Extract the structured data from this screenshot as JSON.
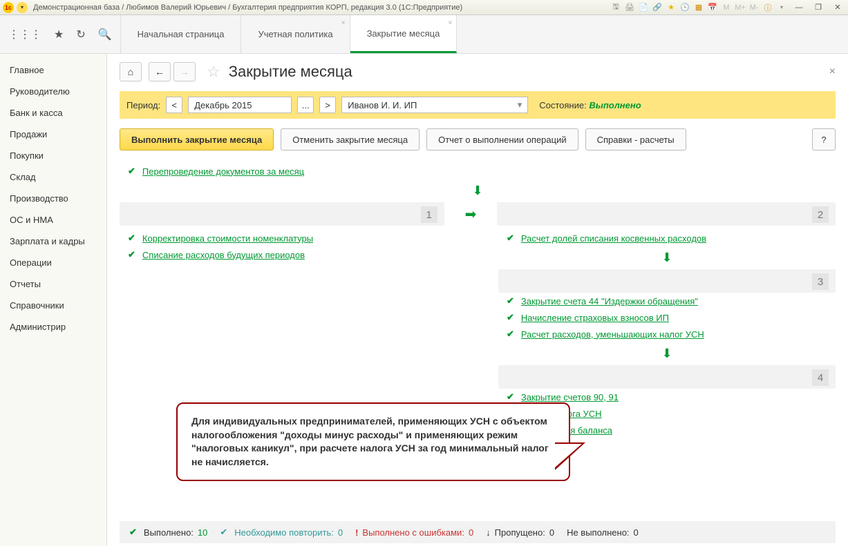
{
  "titlebar": {
    "title": "Демонстрационная база / Любимов Валерий Юрьевич / Бухгалтерия предприятия КОРП, редакция 3.0  (1С:Предприятие)",
    "m_labels": [
      "M",
      "M+",
      "M-"
    ]
  },
  "tabs": {
    "start": "Начальная страница",
    "policy": "Учетная политика",
    "close_month": "Закрытие месяца"
  },
  "sidebar": {
    "items": [
      "Главное",
      "Руководителю",
      "Банк и касса",
      "Продажи",
      "Покупки",
      "Склад",
      "Производство",
      "ОС и НМА",
      "Зарплата и кадры",
      "Операции",
      "Отчеты",
      "Справочники",
      "Администрир"
    ]
  },
  "page": {
    "title": "Закрытие месяца"
  },
  "period": {
    "label": "Период:",
    "value": "Декабрь 2015",
    "org": "Иванов И. И. ИП",
    "status_label": "Состояние:",
    "status_value": "Выполнено"
  },
  "actions": {
    "execute": "Выполнить закрытие месяца",
    "cancel": "Отменить закрытие месяца",
    "report": "Отчет о выполнении операций",
    "calc": "Справки - расчеты",
    "help": "?"
  },
  "operations": {
    "top": "Перепроведение документов за месяц",
    "b1": [
      "Корректировка стоимости номенклатуры",
      "Списание расходов будущих периодов"
    ],
    "b2": [
      "Расчет долей списания косвенных расходов"
    ],
    "b3": [
      "Закрытие счета 44 \"Издержки обращения\"",
      "Начисление страховых взносов ИП",
      "Расчет расходов, уменьшающих налог УСН"
    ],
    "b4": [
      "Закрытие счетов 90, 91",
      "Расчет налога УСН",
      "Реформация баланса"
    ],
    "nums": {
      "b1": "1",
      "b2": "2",
      "b3": "3",
      "b4": "4"
    }
  },
  "callout": {
    "text": "Для индивидуальных предпринимателей, применяющих УСН с объектом налогообложения \"доходы минус расходы\" и применяющих режим \"налоговых каникул\", при расчете налога УСН за год минимальный налог не начисляется."
  },
  "statusbar": {
    "done_label": "Выполнено:",
    "done_count": "10",
    "repeat_label": "Необходимо повторить:",
    "repeat_count": "0",
    "errors_label": "Выполнено с ошибками:",
    "errors_count": "0",
    "skipped_label": "Пропущено:",
    "skipped_count": "0",
    "notdone_label": "Не выполнено:",
    "notdone_count": "0"
  }
}
